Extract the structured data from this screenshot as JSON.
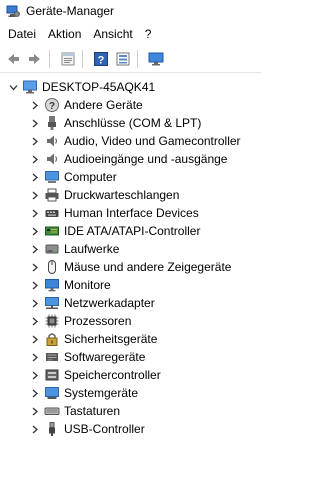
{
  "window": {
    "title": "Geräte-Manager"
  },
  "menu": [
    {
      "label": "Datei"
    },
    {
      "label": "Aktion"
    },
    {
      "label": "Ansicht"
    },
    {
      "label": "?"
    }
  ],
  "toolbar": {
    "buttons": [
      "back-icon",
      "forward-icon",
      "properties-icon",
      "help-icon",
      "view-icon",
      "monitor-icon"
    ]
  },
  "tree": {
    "root": {
      "label": "DESKTOP-45AQK41",
      "icon": "computer-icon",
      "expanded": true
    },
    "items": [
      {
        "label": "Andere Geräte",
        "icon": "unknown-device-icon"
      },
      {
        "label": "Anschlüsse (COM & LPT)",
        "icon": "port-icon"
      },
      {
        "label": "Audio, Video und Gamecontroller",
        "icon": "speaker-icon"
      },
      {
        "label": "Audioeingänge und -ausgänge",
        "icon": "speaker-icon"
      },
      {
        "label": "Computer",
        "icon": "computer-icon"
      },
      {
        "label": "Druckwarteschlangen",
        "icon": "printer-icon"
      },
      {
        "label": "Human Interface Devices",
        "icon": "hid-icon"
      },
      {
        "label": "IDE ATA/ATAPI-Controller",
        "icon": "ide-controller-icon"
      },
      {
        "label": "Laufwerke",
        "icon": "drive-icon"
      },
      {
        "label": "Mäuse und andere Zeigegeräte",
        "icon": "mouse-icon"
      },
      {
        "label": "Monitore",
        "icon": "monitor-icon"
      },
      {
        "label": "Netzwerkadapter",
        "icon": "network-icon"
      },
      {
        "label": "Prozessoren",
        "icon": "processor-icon"
      },
      {
        "label": "Sicherheitsgeräte",
        "icon": "security-icon"
      },
      {
        "label": "Softwaregeräte",
        "icon": "software-device-icon"
      },
      {
        "label": "Speichercontroller",
        "icon": "storage-controller-icon"
      },
      {
        "label": "Systemgeräte",
        "icon": "system-device-icon"
      },
      {
        "label": "Tastaturen",
        "icon": "keyboard-icon"
      },
      {
        "label": "USB-Controller",
        "icon": "usb-icon"
      }
    ]
  },
  "colors": {
    "icon_blue": "#1f6fc9",
    "icon_gray": "#6d6d6d",
    "icon_dark": "#333333"
  }
}
